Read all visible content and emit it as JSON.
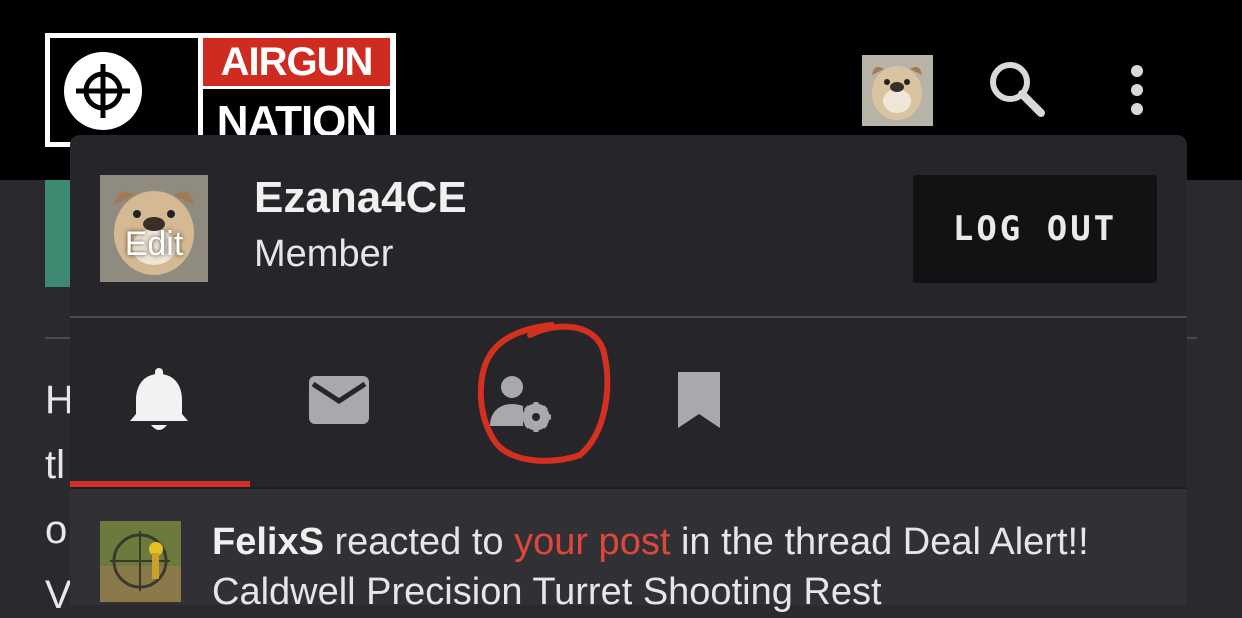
{
  "header": {
    "logo_top": "AIRGUN",
    "logo_bottom": "NATION"
  },
  "background": {
    "letters": [
      "H",
      "tl",
      "o",
      "V"
    ]
  },
  "account": {
    "avatar_edit_label": "Edit",
    "username": "Ezana4CE",
    "role": "Member",
    "logout_label": "LOG OUT"
  },
  "tabs": [
    {
      "icon": "bell-icon",
      "active": true
    },
    {
      "icon": "envelope-icon",
      "active": false
    },
    {
      "icon": "account-settings-icon",
      "active": false
    },
    {
      "icon": "bookmark-icon",
      "active": false
    }
  ],
  "notification": {
    "user": "FelixS",
    "text_1": " reacted to ",
    "link": "your post",
    "text_2": " in the thread Deal Alert!! Caldwell Precision Turret Shooting Rest"
  },
  "colors": {
    "accent_red": "#d02b20",
    "link_red": "#e0473a",
    "panel_bg": "#26262a",
    "header_bg": "#000000",
    "active_tab_underline": "#d0302a"
  }
}
